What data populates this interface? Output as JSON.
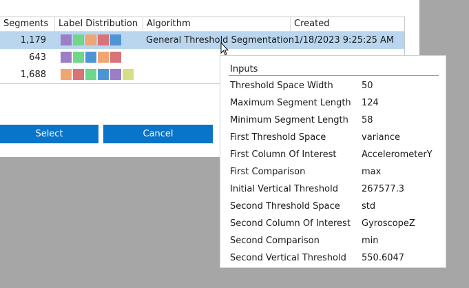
{
  "table": {
    "columns": [
      "Segments",
      "Label Distribution",
      "Algorithm",
      "Created"
    ],
    "rows": [
      {
        "segments": "1,179",
        "swatches": [
          "#9b7dc8",
          "#6fd68a",
          "#eea772",
          "#d97377",
          "#4e95d6"
        ],
        "algorithm": "General Threshold Segmentation",
        "created": "1/18/2023 9:25:25 AM",
        "selected": true
      },
      {
        "segments": "643",
        "swatches": [
          "#9b7dc8",
          "#6fd68a",
          "#4e95d6",
          "#eea772",
          "#d97377"
        ],
        "algorithm": "",
        "created": "",
        "selected": false
      },
      {
        "segments": "1,688",
        "swatches": [
          "#eea772",
          "#d97377",
          "#6fd68a",
          "#4e95d6",
          "#9b7dc8",
          "#d7df86"
        ],
        "algorithm": "",
        "created": "",
        "selected": false
      }
    ]
  },
  "buttons": {
    "select": "Select",
    "cancel": "Cancel"
  },
  "tooltip": {
    "title": "Inputs",
    "items": [
      {
        "key": "Threshold Space Width",
        "value": "50"
      },
      {
        "key": "Maximum Segment Length",
        "value": "124"
      },
      {
        "key": "Minimum Segment Length",
        "value": "58"
      },
      {
        "key": "First Threshold Space",
        "value": "variance"
      },
      {
        "key": "First Column Of Interest",
        "value": "AccelerometerY"
      },
      {
        "key": "First Comparison",
        "value": "max"
      },
      {
        "key": "Initial Vertical Threshold",
        "value": "267577.3"
      },
      {
        "key": "Second Threshold Space",
        "value": "std"
      },
      {
        "key": "Second Column Of Interest",
        "value": "GyroscopeZ"
      },
      {
        "key": "Second Comparison",
        "value": "min"
      },
      {
        "key": "Second Vertical Threshold",
        "value": "550.6047"
      }
    ]
  },
  "colors": {
    "accent": "#0a74c8",
    "selection": "#b9d6ee",
    "backdrop": "#a6a6a6"
  },
  "icons": {
    "cursor": "arrow-cursor-icon"
  }
}
